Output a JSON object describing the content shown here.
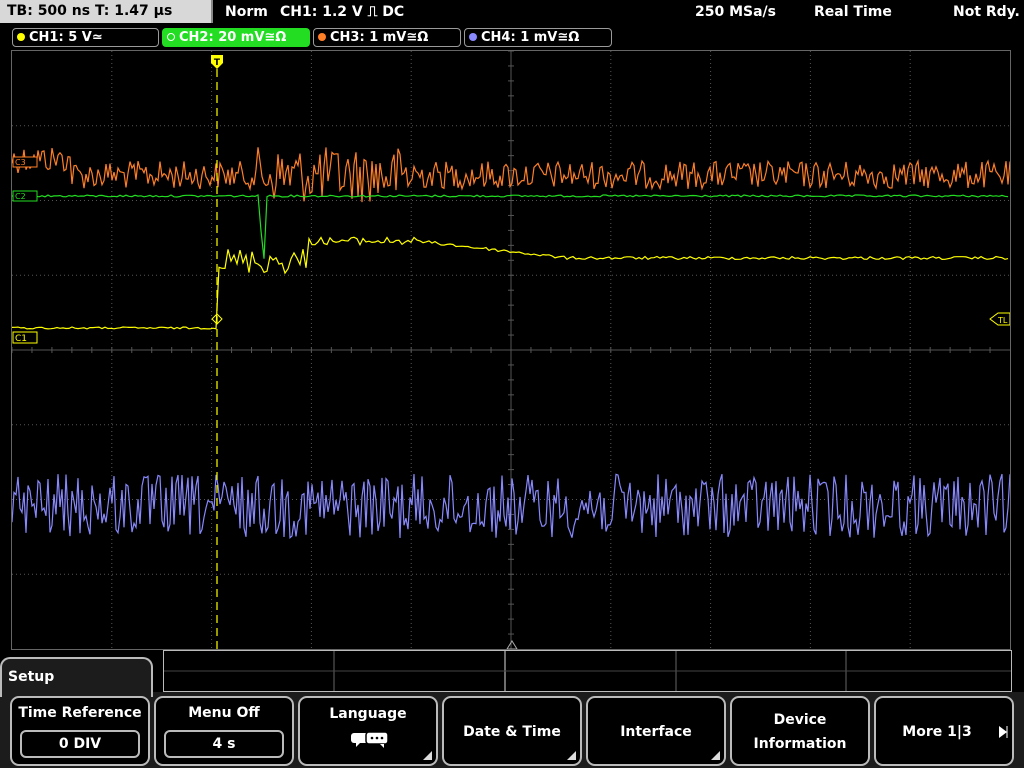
{
  "topbar": {
    "timebase": "TB: 500 ns   T: 1.47 µs",
    "trigger_mode": "Norm",
    "trigger_info": "CH1: 1.2 V ⎍ DC",
    "sample_rate": "250 MSa/s",
    "acq_mode": "Real Time",
    "status": "Not Rdy."
  },
  "channels": [
    {
      "label": "CH1: 5 V≃",
      "color": "#ffff00",
      "active": false
    },
    {
      "label": "CH2: 20 mV≅Ω",
      "color": "#33ee33",
      "active": true
    },
    {
      "label": "CH3: 1 mV≅Ω",
      "color": "#ff7f27",
      "active": false
    },
    {
      "label": "CH4: 1 mV≅Ω",
      "color": "#8888ff",
      "active": false
    }
  ],
  "screen": {
    "trigger_marker": "T",
    "ch1_marker": "C1",
    "ch2_marker": "C2",
    "ch3_marker": "C3",
    "trigger_level_marker": "TL"
  },
  "menu": {
    "title": "Setup",
    "softkeys": [
      {
        "label": "Time Reference",
        "value": "0 DIV",
        "corner": false
      },
      {
        "label": "Menu Off",
        "value": "4 s",
        "corner": false
      },
      {
        "label": "Language",
        "value": "",
        "corner": true
      },
      {
        "label": "Date & Time",
        "value": "",
        "corner": true
      },
      {
        "label": "Interface",
        "value": "",
        "corner": true
      },
      {
        "label": "Device",
        "label2": "Information",
        "value": "",
        "corner": false
      },
      {
        "label": "More 1|3",
        "value": "",
        "corner": false
      }
    ]
  },
  "colors": {
    "ch1": "#ffff00",
    "ch2": "#22dd22",
    "ch3": "#ff7f27",
    "ch4": "#8888ff",
    "grid": "#555555"
  }
}
